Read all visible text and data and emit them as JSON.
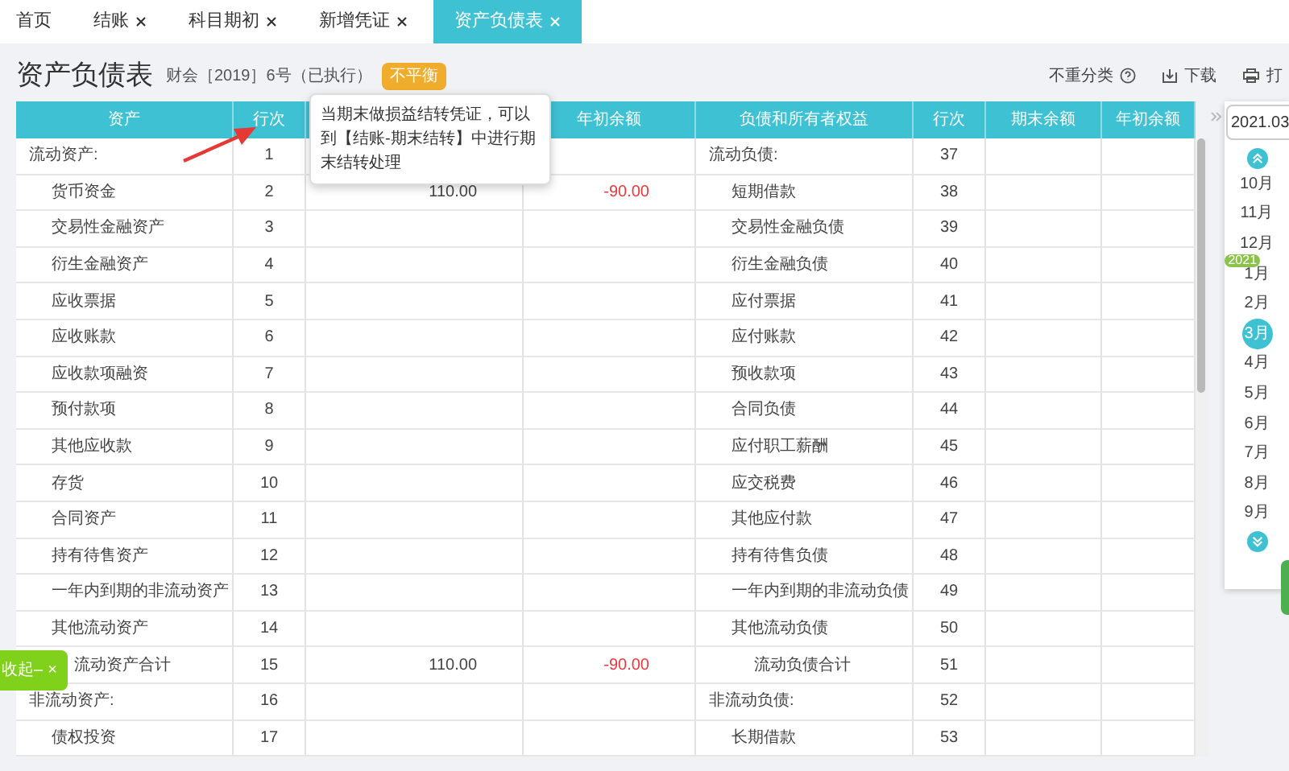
{
  "tabs": [
    {
      "label": "首页",
      "closable": false,
      "selected": false
    },
    {
      "label": "结账",
      "closable": true,
      "selected": false
    },
    {
      "label": "科目期初",
      "closable": true,
      "selected": false
    },
    {
      "label": "新增凭证",
      "closable": true,
      "selected": false
    },
    {
      "label": "资产负债表",
      "closable": true,
      "selected": true
    }
  ],
  "title": "资产负债表",
  "subtitle": "财会［2019］6号（已执行）",
  "badge": "不平衡",
  "tooltip": "当期末做损益结转凭证，可以到【结账-期末结转】中进行期末结转处理",
  "toolbar": [
    {
      "kind": "help",
      "label": "不重分类"
    },
    {
      "kind": "download",
      "label": "下载"
    },
    {
      "kind": "print",
      "label": "打"
    }
  ],
  "table": {
    "columns": [
      "资产",
      "行次",
      "",
      "年初余额",
      "负债和所有者权益",
      "行次",
      "期末余额",
      "年初余额"
    ],
    "rows": [
      {
        "left": {
          "name": "流动资产:",
          "kind": "group",
          "line": "1"
        },
        "right": {
          "name": "流动负债:",
          "kind": "group",
          "line": "37"
        }
      },
      {
        "left": {
          "name": "货币资金",
          "kind": "item",
          "line": "2",
          "end": "110.00",
          "begin": "-90.00",
          "begin_red": true
        },
        "right": {
          "name": "短期借款",
          "kind": "item",
          "line": "38"
        }
      },
      {
        "left": {
          "name": "交易性金融资产",
          "kind": "item",
          "line": "3"
        },
        "right": {
          "name": "交易性金融负债",
          "kind": "item",
          "line": "39"
        }
      },
      {
        "left": {
          "name": "衍生金融资产",
          "kind": "item",
          "line": "4"
        },
        "right": {
          "name": "衍生金融负债",
          "kind": "item",
          "line": "40"
        }
      },
      {
        "left": {
          "name": "应收票据",
          "kind": "item",
          "line": "5"
        },
        "right": {
          "name": "应付票据",
          "kind": "item",
          "line": "41"
        }
      },
      {
        "left": {
          "name": "应收账款",
          "kind": "item",
          "line": "6"
        },
        "right": {
          "name": "应付账款",
          "kind": "item",
          "line": "42"
        }
      },
      {
        "left": {
          "name": "应收款项融资",
          "kind": "item",
          "line": "7"
        },
        "right": {
          "name": "预收款项",
          "kind": "item",
          "line": "43"
        }
      },
      {
        "left": {
          "name": "预付款项",
          "kind": "item",
          "line": "8"
        },
        "right": {
          "name": "合同负债",
          "kind": "item",
          "line": "44"
        }
      },
      {
        "left": {
          "name": "其他应收款",
          "kind": "item",
          "line": "9"
        },
        "right": {
          "name": "应付职工薪酬",
          "kind": "item",
          "line": "45"
        }
      },
      {
        "left": {
          "name": "存货",
          "kind": "item",
          "line": "10"
        },
        "right": {
          "name": "应交税费",
          "kind": "item",
          "line": "46"
        }
      },
      {
        "left": {
          "name": "合同资产",
          "kind": "item",
          "line": "11"
        },
        "right": {
          "name": "其他应付款",
          "kind": "item",
          "line": "47"
        }
      },
      {
        "left": {
          "name": "持有待售资产",
          "kind": "item",
          "line": "12"
        },
        "right": {
          "name": "持有待售负债",
          "kind": "item",
          "line": "48"
        }
      },
      {
        "left": {
          "name": "一年内到期的非流动资产",
          "kind": "item",
          "line": "13"
        },
        "right": {
          "name": "一年内到期的非流动负债",
          "kind": "item",
          "line": "49"
        }
      },
      {
        "left": {
          "name": "其他流动资产",
          "kind": "item",
          "line": "14"
        },
        "right": {
          "name": "其他流动负债",
          "kind": "item",
          "line": "50"
        }
      },
      {
        "left": {
          "name": "流动资产合计",
          "kind": "total",
          "line": "15",
          "end": "110.00",
          "begin": "-90.00",
          "begin_red": true
        },
        "right": {
          "name": "流动负债合计",
          "kind": "total",
          "line": "51"
        }
      },
      {
        "left": {
          "name": "非流动资产:",
          "kind": "group",
          "line": "16"
        },
        "right": {
          "name": "非流动负债:",
          "kind": "group",
          "line": "52"
        }
      },
      {
        "left": {
          "name": "债权投资",
          "kind": "item",
          "line": "17"
        },
        "right": {
          "name": "长期借款",
          "kind": "item",
          "line": "53"
        }
      }
    ]
  },
  "period_picker": {
    "value": "2021.03",
    "year_badge": "2021",
    "months": [
      {
        "label": "10月",
        "selected": false
      },
      {
        "label": "11月",
        "selected": false
      },
      {
        "label": "12月",
        "selected": false
      },
      {
        "label": "1月",
        "selected": false
      },
      {
        "label": "2月",
        "selected": false
      },
      {
        "label": "3月",
        "selected": true
      },
      {
        "label": "4月",
        "selected": false
      },
      {
        "label": "5月",
        "selected": false
      },
      {
        "label": "6月",
        "selected": false
      },
      {
        "label": "7月",
        "selected": false
      },
      {
        "label": "8月",
        "selected": false
      },
      {
        "label": "9月",
        "selected": false
      }
    ]
  },
  "collapse_button": {
    "label": "收起–",
    "close": "×"
  }
}
